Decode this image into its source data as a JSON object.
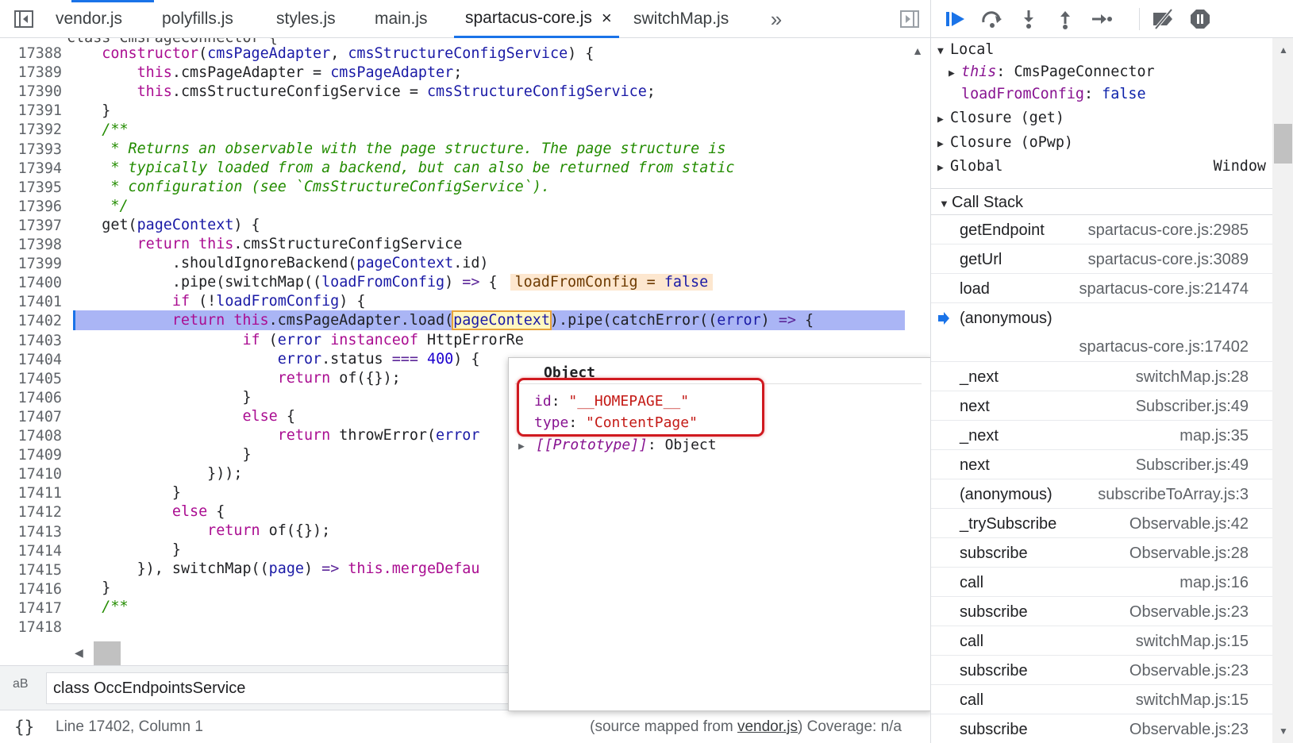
{
  "tabs": {
    "items": [
      {
        "label": "vendor.js"
      },
      {
        "label": "polyfills.js"
      },
      {
        "label": "styles.js"
      },
      {
        "label": "main.js"
      },
      {
        "label": "spartacus-core.js",
        "close": "×"
      },
      {
        "label": "switchMap.js"
      }
    ],
    "more": "»"
  },
  "editor": {
    "partial_top_line": "class CmsPageConnector {",
    "line_numbers": [
      "17388",
      "17389",
      "17390",
      "17391",
      "17392",
      "17393",
      "17394",
      "17395",
      "17396",
      "17397",
      "17398",
      "17399",
      "17400",
      "17401",
      "17402",
      "17403",
      "17404",
      "17405",
      "17406",
      "17407",
      "17408",
      "17409",
      "17410",
      "17411",
      "17412",
      "17413",
      "17414",
      "17415",
      "17416",
      "17417",
      "17418"
    ],
    "tokens": {
      "constructor": "constructor",
      "cmsPageAdapter": "cmsPageAdapter",
      "cmsStructureConfigService": "cmsStructureConfigService",
      "this": "this",
      "comment1": "/**",
      "comment2": " * Returns an observable with the page structure. The page structure is",
      "comment3": " * typically loaded from a backend, but can also be returned from static",
      "comment4": " * configuration (see `CmsStructureConfigService`).",
      "comment5": " */",
      "get": "get",
      "pageContext": "pageContext",
      "return": "return",
      "shouldIgnoreBackend": ".shouldIgnoreBackend(",
      "id": ".id)",
      "pipe_switchMap": ".pipe(switchMap((",
      "loadFromConfig": "loadFromConfig",
      "arrow": "=>",
      "inline_key": "loadFromConfig",
      "inline_eq": " = ",
      "inline_val": "false",
      "if": "if",
      "load": ".cmsPageAdapter.load(",
      "pipe_catchError": ").pipe(catchError((",
      "error": "error",
      "instanceof": "instanceof",
      "HttpErrorResponse_part": "HttpErrorRe",
      "status": ".status",
      "eqeqeq": "===",
      "n400": "400",
      "of_empty": "of({});",
      "else": "else",
      "throwError": "throwError(",
      "close_pipe": "}));",
      "close_switch": "}), switchMap((",
      "page": "page",
      "mergeDefau": "this.mergeDefau",
      "comment6": "/**"
    }
  },
  "search": {
    "value": "class OccEndpointsService",
    "case_icon": "aB"
  },
  "status": {
    "format_icon": "{}",
    "position": "Line 17402, Column 1",
    "source_mapped_prefix": "(source mapped from ",
    "source_mapped_link": "vendor.js",
    "source_mapped_suffix": ")",
    "coverage": "Coverage: n/a"
  },
  "popover": {
    "title": "Object",
    "props": [
      {
        "key": "id",
        "value": "\"__HOMEPAGE__\""
      },
      {
        "key": "type",
        "value": "\"ContentPage\""
      }
    ],
    "proto_key": "[[Prototype]]",
    "proto_value": "Object"
  },
  "debugger": {
    "toolbar_icons": [
      "resume-icon",
      "step-over-icon",
      "step-into-icon",
      "step-out-icon",
      "step-icon",
      "deactivate-breakpoints-icon",
      "pause-on-exceptions-icon"
    ],
    "scope": {
      "local": "Local",
      "this_key": "this",
      "this_value": "CmsPageConnector",
      "lfc_key": "loadFromConfig",
      "lfc_value": "false",
      "closure_get": "Closure (get)",
      "closure_opwp": "Closure (oPwp)",
      "global": "Global",
      "global_value": "Window"
    },
    "call_stack_title": "Call Stack",
    "frames": [
      {
        "fn": "getEndpoint",
        "loc": "spartacus-core.js:2985"
      },
      {
        "fn": "getUrl",
        "loc": "spartacus-core.js:3089"
      },
      {
        "fn": "load",
        "loc": "spartacus-core.js:21474"
      },
      {
        "fn": "(anonymous)",
        "loc": "spartacus-core.js:17402",
        "current": true
      },
      {
        "fn": "_next",
        "loc": "switchMap.js:28"
      },
      {
        "fn": "next",
        "loc": "Subscriber.js:49"
      },
      {
        "fn": "_next",
        "loc": "map.js:35"
      },
      {
        "fn": "next",
        "loc": "Subscriber.js:49"
      },
      {
        "fn": "(anonymous)",
        "loc": "subscribeToArray.js:3"
      },
      {
        "fn": "_trySubscribe",
        "loc": "Observable.js:42"
      },
      {
        "fn": "subscribe",
        "loc": "Observable.js:28"
      },
      {
        "fn": "call",
        "loc": "map.js:16"
      },
      {
        "fn": "subscribe",
        "loc": "Observable.js:23"
      },
      {
        "fn": "call",
        "loc": "switchMap.js:15"
      },
      {
        "fn": "subscribe",
        "loc": "Observable.js:23"
      },
      {
        "fn": "call",
        "loc": "switchMap.js:15"
      },
      {
        "fn": "subscribe",
        "loc": "Observable.js:23"
      }
    ]
  },
  "colors": {
    "accent": "#1a73e8",
    "current_line": "#aab5f5",
    "annotation": "#d0191f"
  }
}
